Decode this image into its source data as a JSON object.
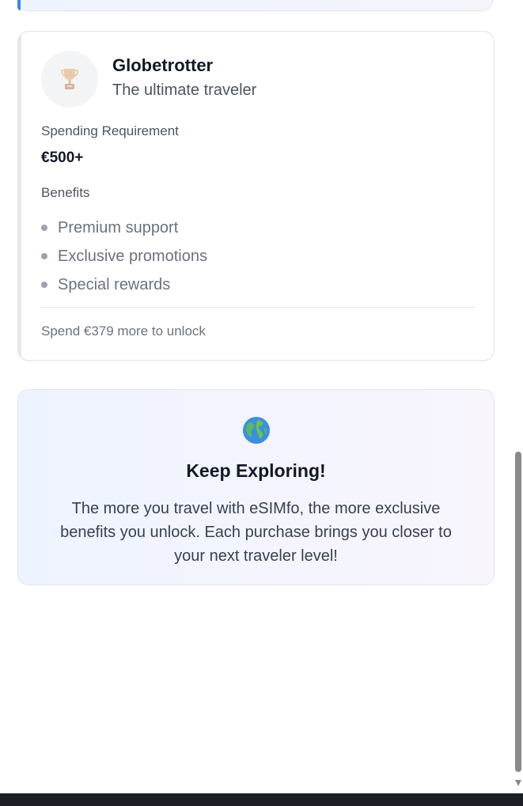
{
  "tier": {
    "name": "Globetrotter",
    "tagline": "The ultimate traveler",
    "icon": "trophy-icon",
    "spending_label": "Spending Requirement",
    "spending_value": "€500+",
    "benefits_label": "Benefits",
    "benefits": [
      "Premium support",
      "Exclusive promotions",
      "Special rewards"
    ],
    "unlock_text": "Spend €379 more to unlock"
  },
  "explore": {
    "icon": "globe-icon",
    "title": "Keep Exploring!",
    "text": "The more you travel with eSIMfo, the more exclusive benefits you unlock. Each purchase brings you closer to your next traveler level!"
  },
  "colors": {
    "accent_blue": "#3b82f6",
    "card_border": "#e5e7eb",
    "explore_bg_start": "#eef4ff",
    "explore_bg_end": "#f8f5fd"
  }
}
